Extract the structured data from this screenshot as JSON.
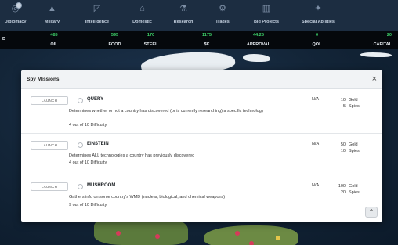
{
  "nav": {
    "items": [
      {
        "label": "Diplomacy",
        "icon": "diplomacy-icon",
        "glyph": "◎"
      },
      {
        "label": "Military",
        "icon": "military-icon",
        "glyph": "▲"
      },
      {
        "label": "Intelligence",
        "icon": "intelligence-icon",
        "glyph": "◸"
      },
      {
        "label": "Domestic",
        "icon": "domestic-icon",
        "glyph": "⌂"
      },
      {
        "label": "Research",
        "icon": "research-icon",
        "glyph": "⚗"
      },
      {
        "label": "Trades",
        "icon": "trades-icon",
        "glyph": "⚙"
      },
      {
        "label": "Big Projects",
        "icon": "big-projects-icon",
        "glyph": "▥"
      },
      {
        "label": "Special Abilities",
        "icon": "special-abilities-icon",
        "glyph": "✦"
      }
    ]
  },
  "resources": [
    {
      "value": "",
      "name": "D"
    },
    {
      "value": "485",
      "name": "OIL"
    },
    {
      "value": "595",
      "name": "FOOD"
    },
    {
      "value": "170",
      "name": "STEEL"
    },
    {
      "value": "1175",
      "name": "$K"
    },
    {
      "value": "44.25",
      "name": "APPROVAL"
    },
    {
      "value": "0",
      "name": "QOL"
    },
    {
      "value": "20",
      "name": "CAPITAL"
    }
  ],
  "modal": {
    "title": "Spy Missions",
    "close": "×",
    "scroll_up": "⌃"
  },
  "missions": [
    {
      "launch": "LAUNCH",
      "name": "QUERY",
      "description": "Determines whether or not a country has discovered (or is currently researching) a specific technology",
      "difficulty": "4 out of 10 Difficulty",
      "status": "N/A",
      "gold": "10",
      "gold_label": "Gold",
      "spies": "5",
      "spies_label": "Spies"
    },
    {
      "launch": "LAUNCH",
      "name": "EINSTEIN",
      "description": "Determines ALL technologies a country has previously discovered",
      "difficulty": "4 out of 10 Difficulty",
      "status": "N/A",
      "gold": "50",
      "gold_label": "Gold",
      "spies": "10",
      "spies_label": "Spies"
    },
    {
      "launch": "LAUNCH",
      "name": "MUSHROOM",
      "description": "Gathers info on some country's WMD (nuclear, biological, and chemical weapons)",
      "difficulty": "9 out of 10 Difficulty",
      "status": "N/A",
      "gold": "100",
      "gold_label": "Gold",
      "spies": "20",
      "spies_label": "Spies"
    }
  ],
  "colors": {
    "nav_bg": "#1c2d41",
    "resource_value": "#3ed26a",
    "resource_bar_bg": "#05080c"
  }
}
